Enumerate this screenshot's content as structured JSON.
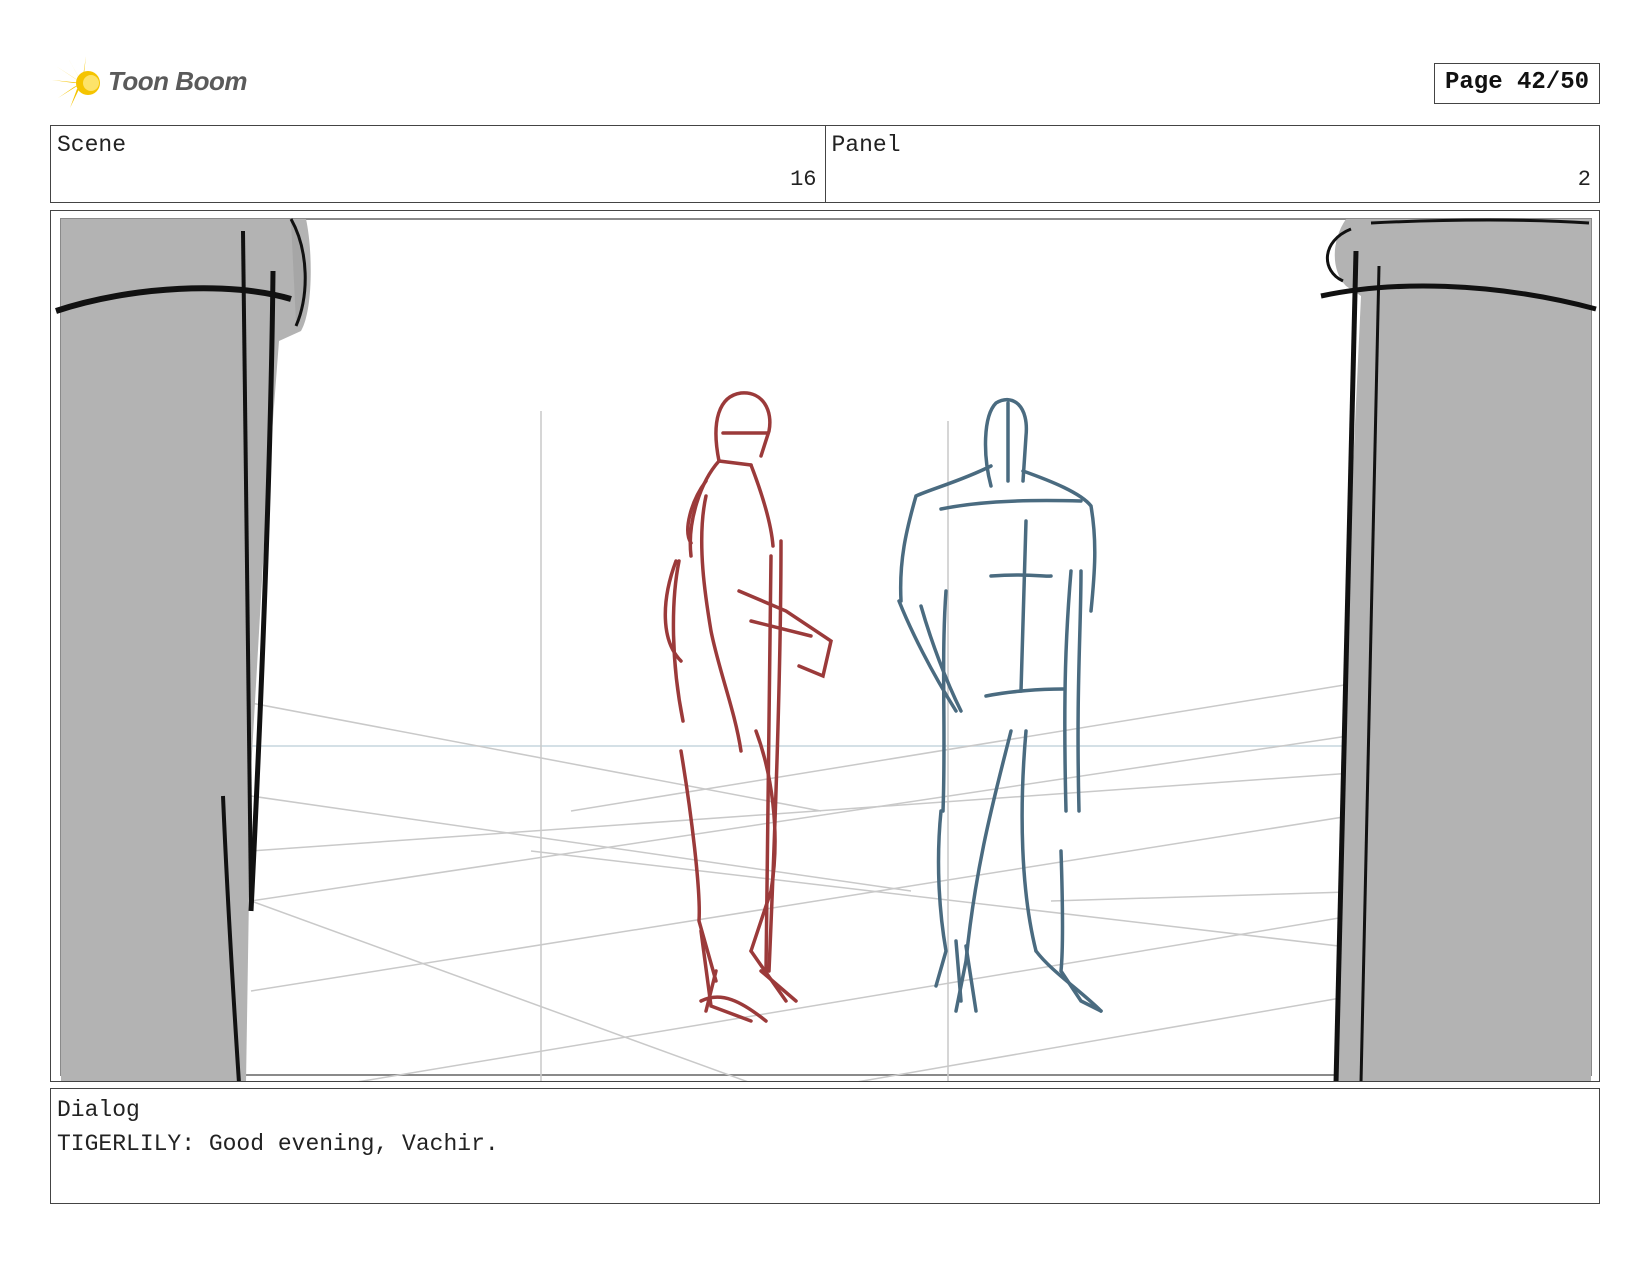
{
  "logo": {
    "text": "Toon Boom",
    "icon": "starburst-icon",
    "color": "#f5c400"
  },
  "page": {
    "label": "Page 42/50"
  },
  "header": {
    "scene_label": "Scene",
    "scene_value": "16",
    "panel_label": "Panel",
    "panel_value": "2"
  },
  "panel_image": {
    "left_character_color": "#9b3a3a",
    "right_character_color": "#4a6b80",
    "pillar_color": "#b3b3b3"
  },
  "dialog": {
    "label": "Dialog",
    "text": "TIGERLILY: Good evening, Vachir."
  }
}
